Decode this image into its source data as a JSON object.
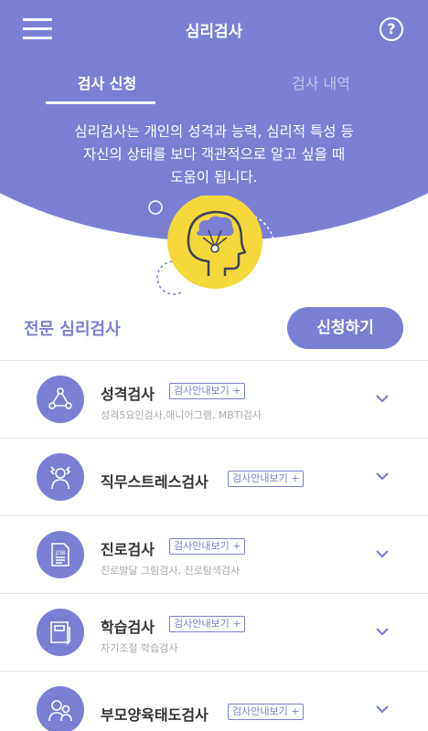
{
  "header": {
    "title": "심리검사",
    "menu_icon": "hamburger-menu-icon",
    "help_label": "?"
  },
  "tabs": [
    {
      "label": "검사 신청",
      "active": true
    },
    {
      "label": "검사 내역",
      "active": false
    }
  ],
  "hero": {
    "lines": [
      "심리검사는 개인의 성격과 능력, 심리적 특성 등",
      "자신의 상태를 보다 객관적으로 알고 싶을 때",
      "도움이 됩니다."
    ],
    "illustration": "head-brain-icon"
  },
  "section": {
    "title": "전문 심리검사",
    "apply_label": "신청하기"
  },
  "items": [
    {
      "name": "성격검사",
      "guide": "검사안내보기 +",
      "sub": "성격5요인검사,애니어그램, MBTI검사",
      "icon": "people-network-icon"
    },
    {
      "name": "직무스트레스검사",
      "guide": "검사안내보기 +",
      "sub": "",
      "icon": "stressed-person-icon"
    },
    {
      "name": "진로검사",
      "guide": "검사안내보기 +",
      "sub": "진로발달 그림검사, 진로탐색검사",
      "icon": "job-document-icon"
    },
    {
      "name": "학습검사",
      "guide": "검사안내보기 +",
      "sub": "자기조절 학습검사",
      "icon": "notebook-icon"
    },
    {
      "name": "부모양육태도검사",
      "guide": "검사안내보기 +",
      "sub": "",
      "icon": "parent-child-icon"
    }
  ],
  "colors": {
    "accent": "#7b7fd4",
    "illustration": "#f5d83a"
  }
}
